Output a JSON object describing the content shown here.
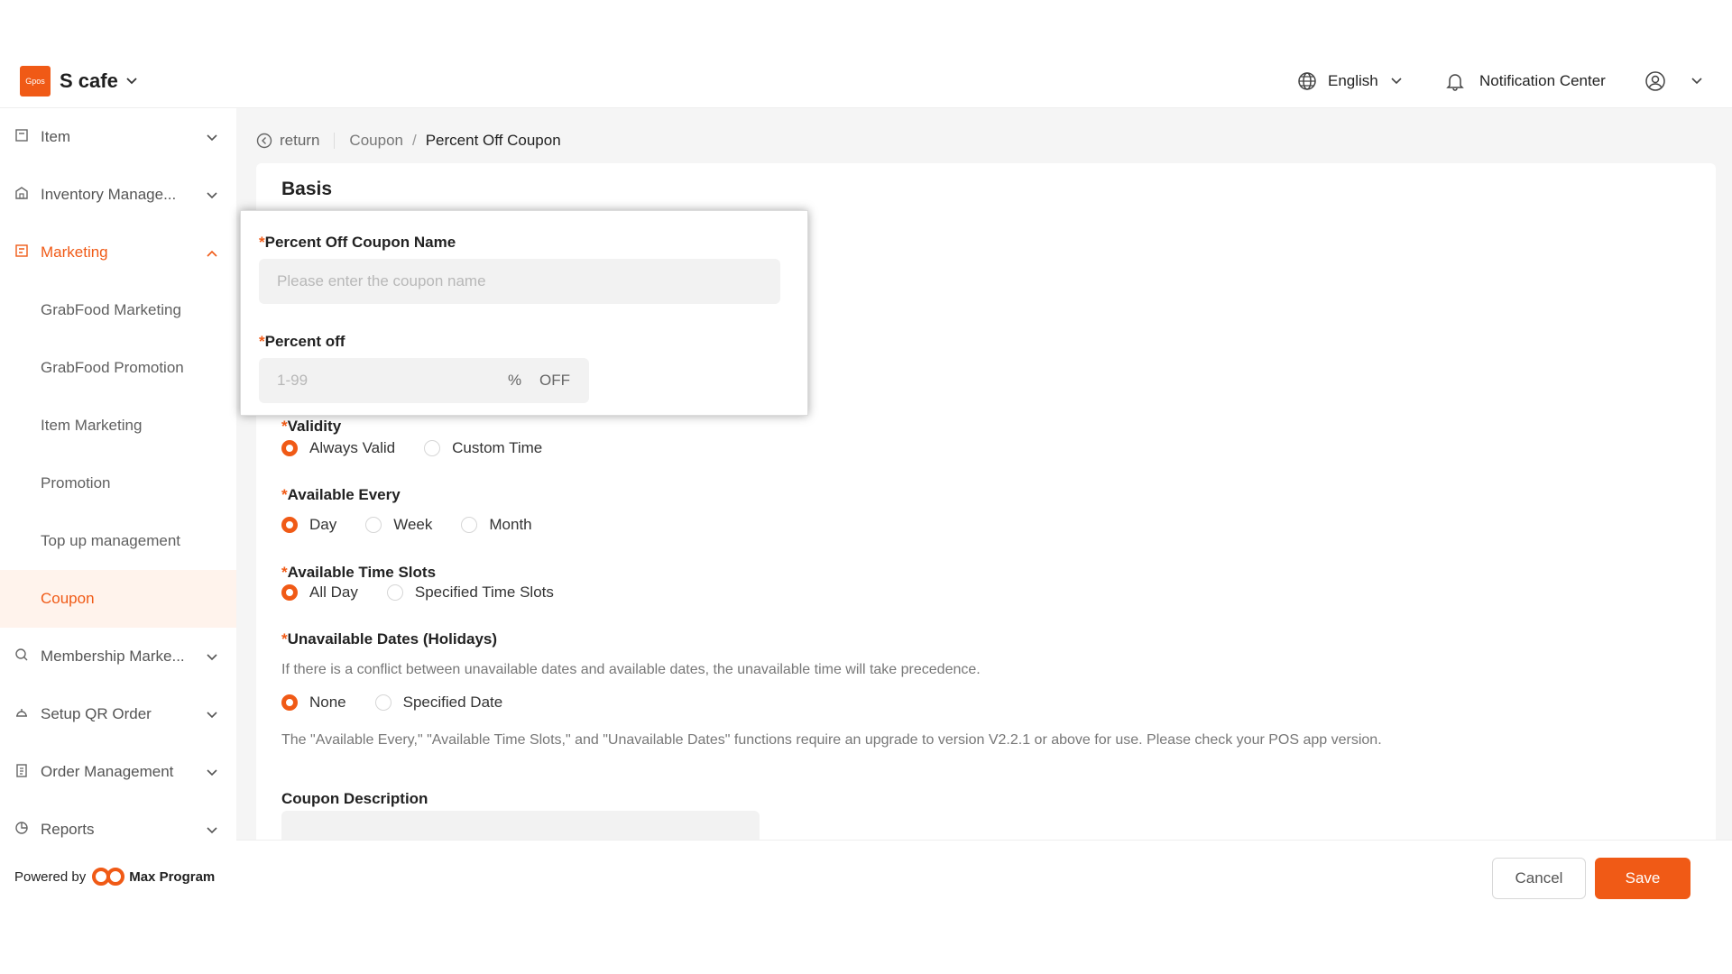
{
  "header": {
    "logo_text": "Gpos",
    "store_name": "S cafe",
    "language": "English",
    "notification": "Notification Center"
  },
  "sidebar": {
    "items": [
      {
        "label": "Item"
      },
      {
        "label": "Inventory Manage..."
      },
      {
        "label": "Marketing"
      },
      {
        "label": "GrabFood Marketing"
      },
      {
        "label": "GrabFood Promotion"
      },
      {
        "label": "Item Marketing"
      },
      {
        "label": "Promotion"
      },
      {
        "label": "Top up management"
      },
      {
        "label": "Coupon"
      },
      {
        "label": "Membership Marke..."
      },
      {
        "label": "Setup QR Order"
      },
      {
        "label": "Order Management"
      },
      {
        "label": "Reports"
      }
    ],
    "powered_by": "Powered by",
    "brand": "Max Program"
  },
  "breadcrumb": {
    "return": "return",
    "parent": "Coupon",
    "separator": "/",
    "current": "Percent Off Coupon"
  },
  "form": {
    "section_title": "Basis",
    "required_mark": "*",
    "coupon_name_label": "Percent Off Coupon Name",
    "coupon_name_placeholder": "Please enter the coupon name",
    "percent_off_label": "Percent off",
    "percent_off_placeholder": "1-99",
    "percent_symbol": "%",
    "off_text": "OFF",
    "validity_label": "Validity",
    "validity_options": [
      "Always Valid",
      "Custom Time"
    ],
    "available_every_label": "Available Every",
    "available_every_options": [
      "Day",
      "Week",
      "Month"
    ],
    "time_slots_label": "Available Time Slots",
    "time_slots_options": [
      "All Day",
      "Specified Time Slots"
    ],
    "unavailable_label": "Unavailable Dates (Holidays)",
    "unavailable_hint": "If there is a conflict between unavailable dates and available dates, the unavailable time will take precedence.",
    "unavailable_options": [
      "None",
      "Specified Date"
    ],
    "version_note": "The \"Available Every,\" \"Available Time Slots,\" and \"Unavailable Dates\" functions require an upgrade to version V2.2.1 or above for use. Please check your POS app version.",
    "description_label": "Coupon Description"
  },
  "footer": {
    "cancel": "Cancel",
    "save": "Save"
  },
  "colors": {
    "accent": "#f05a16",
    "active_bg": "#fff3ec"
  }
}
